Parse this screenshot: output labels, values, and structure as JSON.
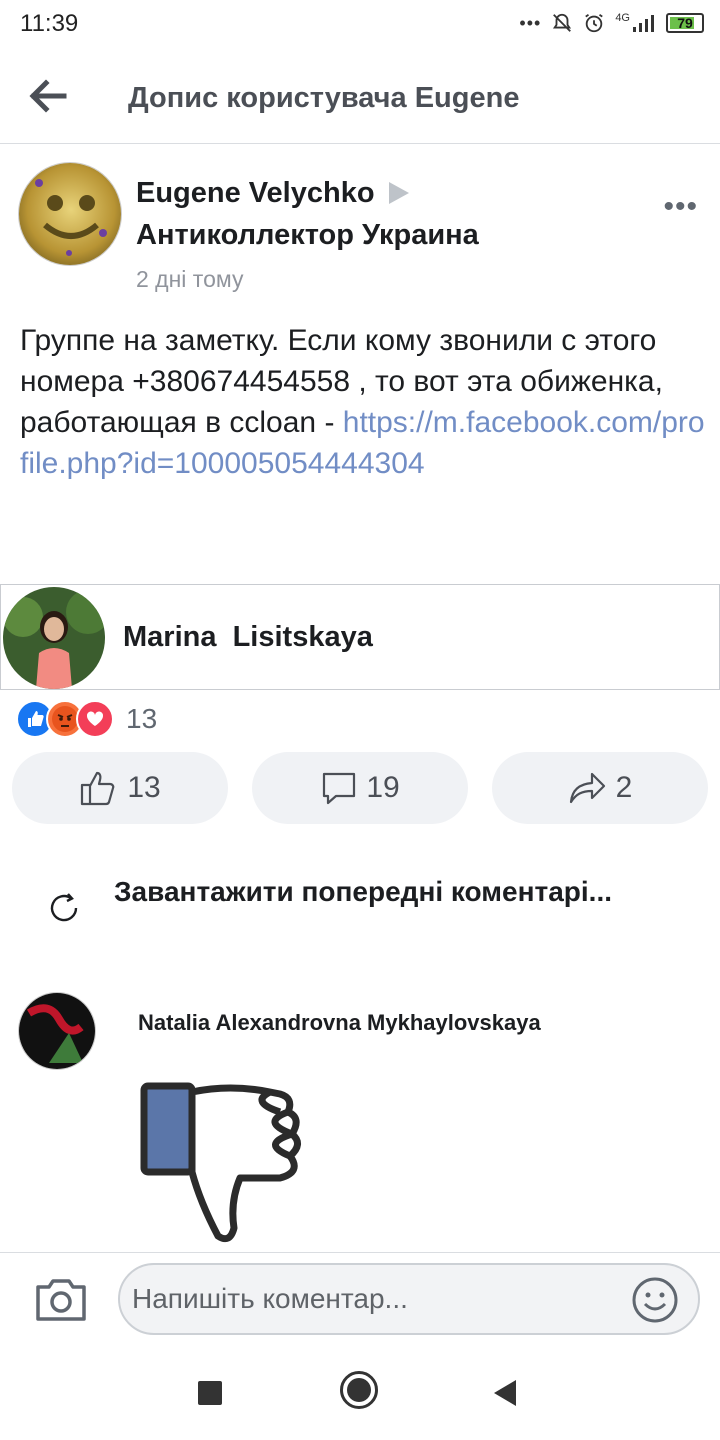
{
  "status_bar": {
    "time": "11:39",
    "network": "4G",
    "battery": "79",
    "battery_level": 0.79,
    "icons": [
      "more-dots-icon",
      "bell-off-icon",
      "alarm-icon",
      "signal-icon",
      "battery-icon"
    ]
  },
  "nav": {
    "title": "Допис користувача Eugene",
    "back_icon": "back-arrow-icon"
  },
  "post": {
    "author": "Eugene Velychko",
    "group": "Антиколлектор Украина",
    "time": "2 дні тому",
    "more_icon": "more-icon",
    "more_label": "•••",
    "text": "Группе на заметку. Если кому звонили с этого номера +380674454558 , то вот эта обиженка, работающая в ccloan - ",
    "link": "https://m.facebook.com/profile.php?id=100005054444304"
  },
  "profile_card": {
    "name": "Marina  Lisitskaya"
  },
  "reactions": {
    "icons": [
      "like-reaction-icon",
      "angry-reaction-icon",
      "love-reaction-icon"
    ],
    "count": "13",
    "colors": {
      "like": "#1877f2",
      "angry": "#f7713c",
      "love": "#f33e58"
    }
  },
  "actions": {
    "like_count": "13",
    "comment_count": "19",
    "share_count": "2"
  },
  "comments": {
    "load_previous": "Завантажити попередні коментарі...",
    "items": [
      {
        "author": "Natalia Alexandrovna Mykhaylovskaya",
        "content_icon": "thumbs-down-icon"
      }
    ]
  },
  "composer": {
    "placeholder": "Напишіть коментар...",
    "camera_icon": "camera-icon",
    "emoji_icon": "emoji-icon"
  },
  "system_nav": [
    "recents-icon",
    "home-icon",
    "back-icon"
  ],
  "colors": {
    "link": "#4267b2",
    "secondary_text": "#90949c",
    "button_bg": "#f0f2f5"
  }
}
